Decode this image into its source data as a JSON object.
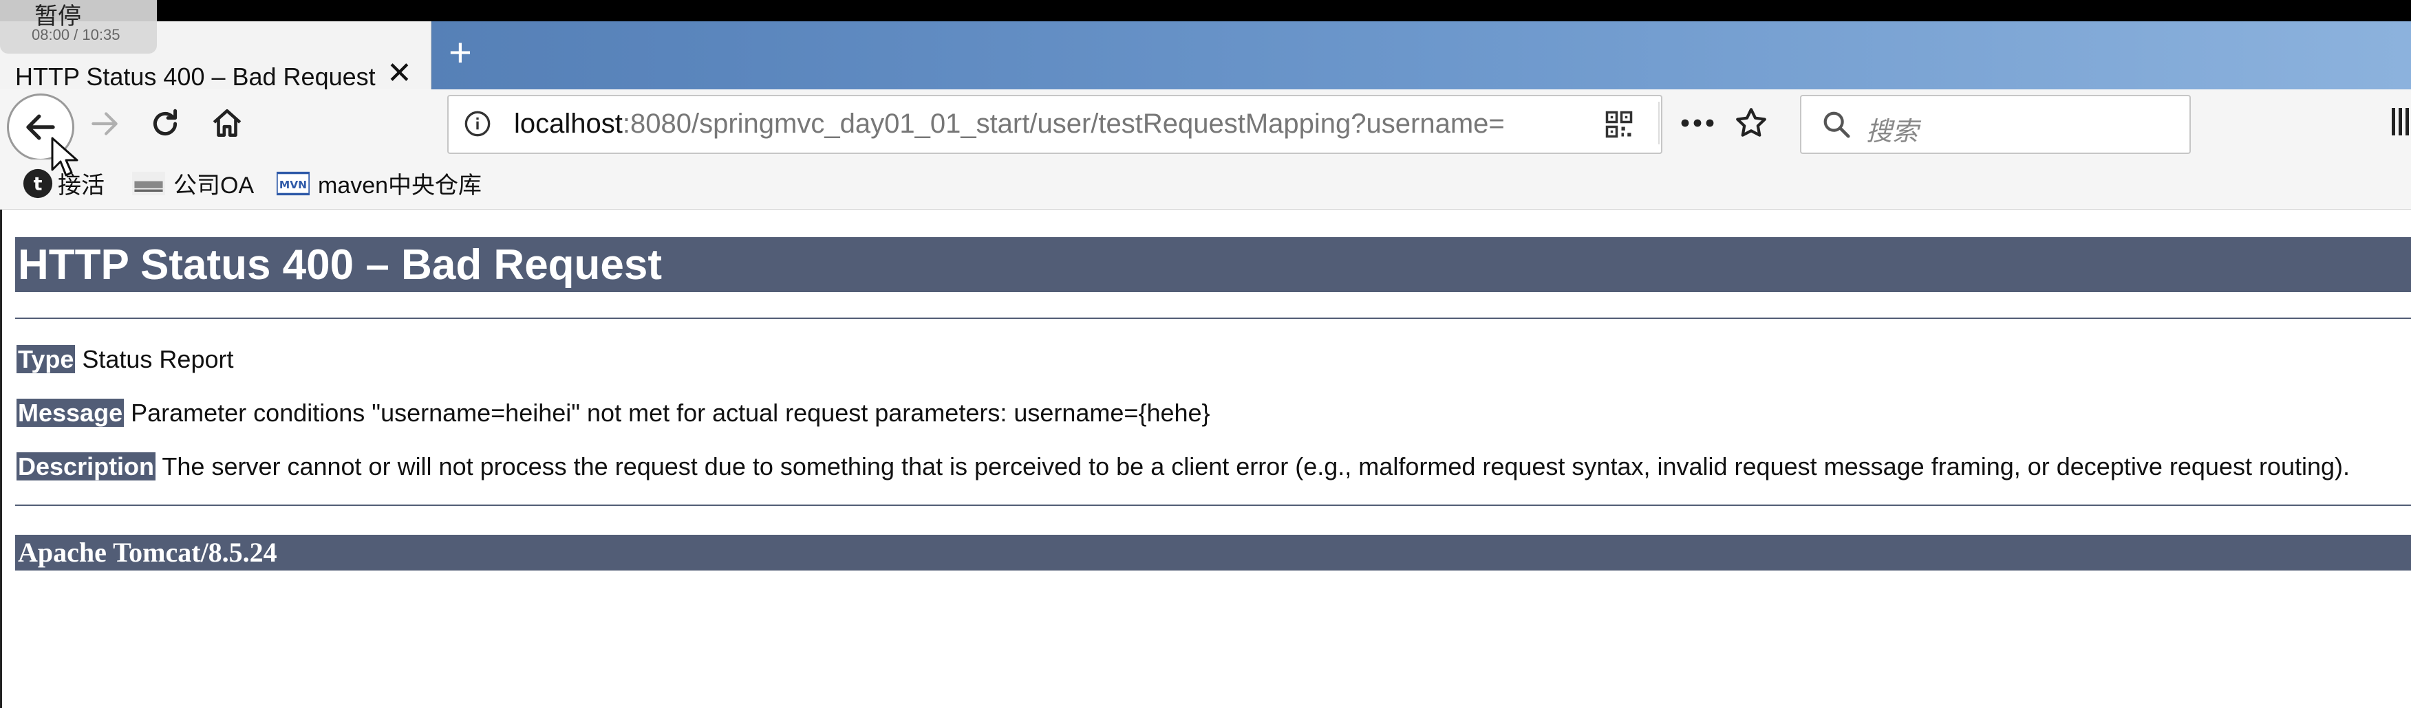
{
  "video_overlay": {
    "label": "暂停",
    "time": "08:00 / 10:35"
  },
  "tab": {
    "title": "HTTP Status 400 – Bad Request",
    "close": "✕"
  },
  "newtab": "+",
  "url": {
    "host": "localhost",
    "path": ":8080/springmvc_day01_01_start/user/testRequestMapping?username="
  },
  "search": {
    "placeholder": "搜索"
  },
  "bookmarks": [
    {
      "label": "接活"
    },
    {
      "label": "公司OA"
    },
    {
      "label": "maven中央仓库"
    }
  ],
  "page": {
    "title": "HTTP Status 400 – Bad Request",
    "type_label": "Type",
    "type_value": "Status Report",
    "message_label": "Message",
    "message_value": "Parameter conditions \"username=heihei\" not met for actual request parameters: username={hehe}",
    "description_label": "Description",
    "description_value": "The server cannot or will not process the request due to something that is perceived to be a client error (e.g., malformed request syntax, invalid request message framing, or deceptive request routing).",
    "footer": "Apache Tomcat/8.5.24"
  },
  "colors": {
    "tomcat_bar": "#525d76",
    "tab_strip": "#5b86bd"
  }
}
